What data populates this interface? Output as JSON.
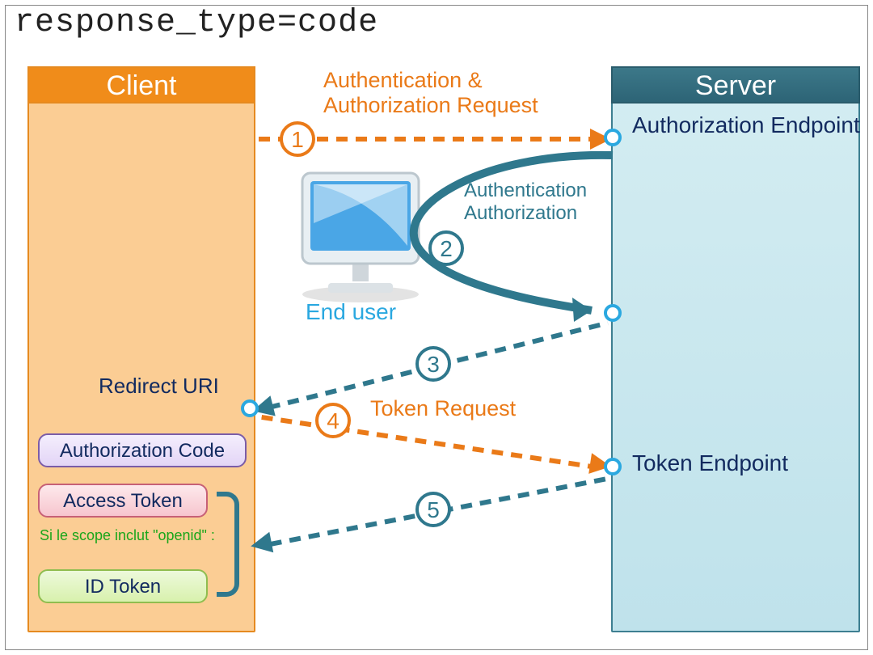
{
  "title": "response_type=code",
  "client": {
    "header": "Client",
    "redirect_uri_label": "Redirect URI",
    "auth_code": "Authorization Code",
    "access_token": "Access Token",
    "id_token": "ID Token",
    "scope_note": "Si le scope inclut \"openid\" :"
  },
  "server": {
    "header": "Server",
    "authorization_endpoint": "Authorization Endpoint",
    "token_endpoint": "Token Endpoint"
  },
  "end_user_label": "End user",
  "steps": {
    "s1": {
      "n": "1",
      "label": "Authentication & Authorization Request"
    },
    "s2": {
      "n": "2",
      "label": "Authentication Authorization"
    },
    "s3": {
      "n": "3"
    },
    "s4": {
      "n": "4",
      "label": "Token Request"
    },
    "s5": {
      "n": "5"
    }
  },
  "colors": {
    "orange": "#ea7a18",
    "teal": "#2f788d",
    "node_ring": "#2aa8e0",
    "navy": "#122a5f"
  }
}
